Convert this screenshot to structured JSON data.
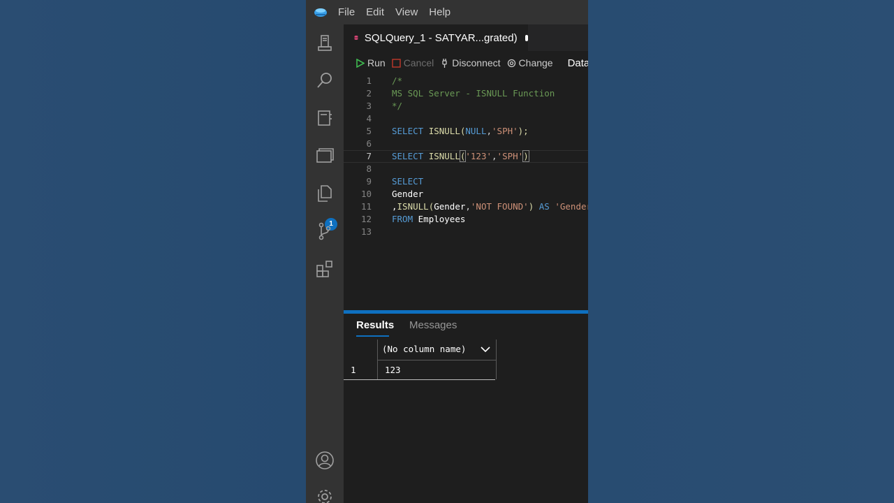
{
  "menu": [
    "File",
    "Edit",
    "View",
    "Help"
  ],
  "tab": {
    "title": "SQLQuery_1 - SATYAR...grated)"
  },
  "toolbar": {
    "run": "Run",
    "cancel": "Cancel",
    "disconnect": "Disconnect",
    "change": "Change",
    "database": "Databas"
  },
  "activity_badge": "1",
  "code": {
    "line_numbers": [
      "1",
      "2",
      "3",
      "4",
      "5",
      "6",
      "7",
      "8",
      "9",
      "10",
      "11",
      "12",
      "13"
    ],
    "l1": "/*",
    "l2": "MS SQL Server - ISNULL Function",
    "l3": "*/",
    "l5": {
      "kw": "SELECT",
      "fn": "ISNULL",
      "open": "(",
      "null": "NULL",
      "comma": ",",
      "str": "'SPH'",
      "close": ");"
    },
    "l7": {
      "kw": "SELECT",
      "fn": "ISNULL",
      "open": "(",
      "str1": "'123'",
      "comma": ",",
      "str2": "'SPH'",
      "close": ")"
    },
    "l9": "SELECT",
    "l10": "Gender",
    "l11": {
      "prefix": ",",
      "fn": "ISNULL",
      "open": "(",
      "col": "Gender",
      "comma": ",",
      "str": "'NOT FOUND'",
      "close": ")",
      "as": "AS",
      "alias": "'Gender"
    },
    "l12": {
      "kw": "FROM",
      "table": "Employees"
    }
  },
  "results": {
    "tabs": [
      "Results",
      "Messages"
    ],
    "column_header": "(No column name)",
    "rows": [
      {
        "num": "1",
        "value": "123"
      }
    ]
  }
}
